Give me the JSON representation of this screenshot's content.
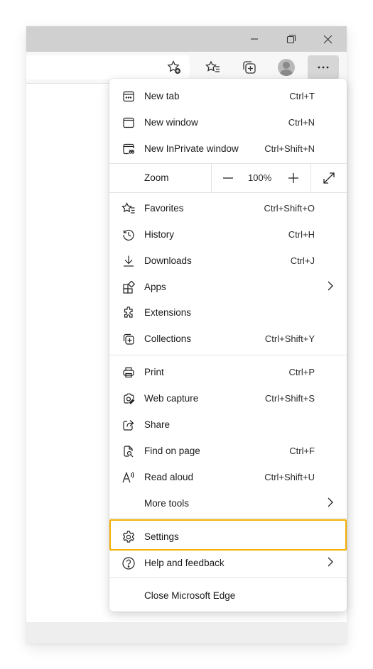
{
  "window": {
    "minimize_icon": "minimize-icon",
    "restore_icon": "restore-icon",
    "close_icon": "close-icon"
  },
  "toolbar": {
    "add_favorite_icon": "add-favorite-icon",
    "favorites_icon": "favorites-icon",
    "collections_icon": "collections-icon",
    "profile_icon": "profile-icon",
    "more_icon": "more-icon",
    "more_label": "···"
  },
  "menu": {
    "new_tab": {
      "label": "New tab",
      "shortcut": "Ctrl+T"
    },
    "new_window": {
      "label": "New window",
      "shortcut": "Ctrl+N"
    },
    "new_inprivate": {
      "label": "New InPrivate window",
      "shortcut": "Ctrl+Shift+N"
    },
    "zoom": {
      "label": "Zoom",
      "value": "100%"
    },
    "favorites": {
      "label": "Favorites",
      "shortcut": "Ctrl+Shift+O"
    },
    "history": {
      "label": "History",
      "shortcut": "Ctrl+H"
    },
    "downloads": {
      "label": "Downloads",
      "shortcut": "Ctrl+J"
    },
    "apps": {
      "label": "Apps"
    },
    "extensions": {
      "label": "Extensions"
    },
    "collections": {
      "label": "Collections",
      "shortcut": "Ctrl+Shift+Y"
    },
    "print": {
      "label": "Print",
      "shortcut": "Ctrl+P"
    },
    "web_capture": {
      "label": "Web capture",
      "shortcut": "Ctrl+Shift+S"
    },
    "share": {
      "label": "Share"
    },
    "find_on_page": {
      "label": "Find on page",
      "shortcut": "Ctrl+F"
    },
    "read_aloud": {
      "label": "Read aloud",
      "shortcut": "Ctrl+Shift+U"
    },
    "more_tools": {
      "label": "More tools"
    },
    "settings": {
      "label": "Settings"
    },
    "help_feedback": {
      "label": "Help and feedback"
    },
    "close_edge": {
      "label": "Close Microsoft Edge"
    }
  },
  "colors": {
    "highlight": "#f3b000",
    "titlebar": "#d0d0d0"
  }
}
